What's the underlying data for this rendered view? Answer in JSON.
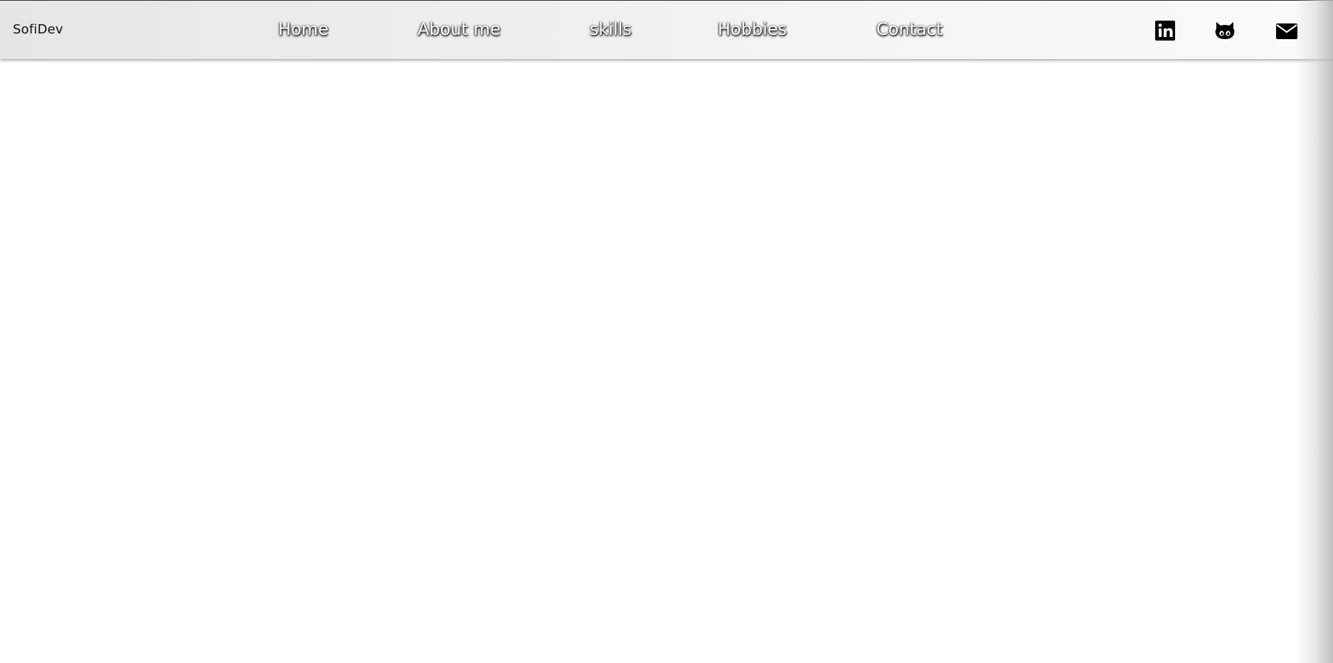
{
  "header": {
    "brand": "SofiDev",
    "nav": [
      {
        "label": "Home"
      },
      {
        "label": "About me"
      },
      {
        "label": "skills"
      },
      {
        "label": "Hobbies"
      },
      {
        "label": "Contact"
      }
    ],
    "social_icons": [
      "linkedin-icon",
      "github-icon",
      "mail-icon"
    ]
  },
  "colors": {
    "nav_text": "#ffffff",
    "brand_text": "#111111",
    "icons": "#000000"
  }
}
